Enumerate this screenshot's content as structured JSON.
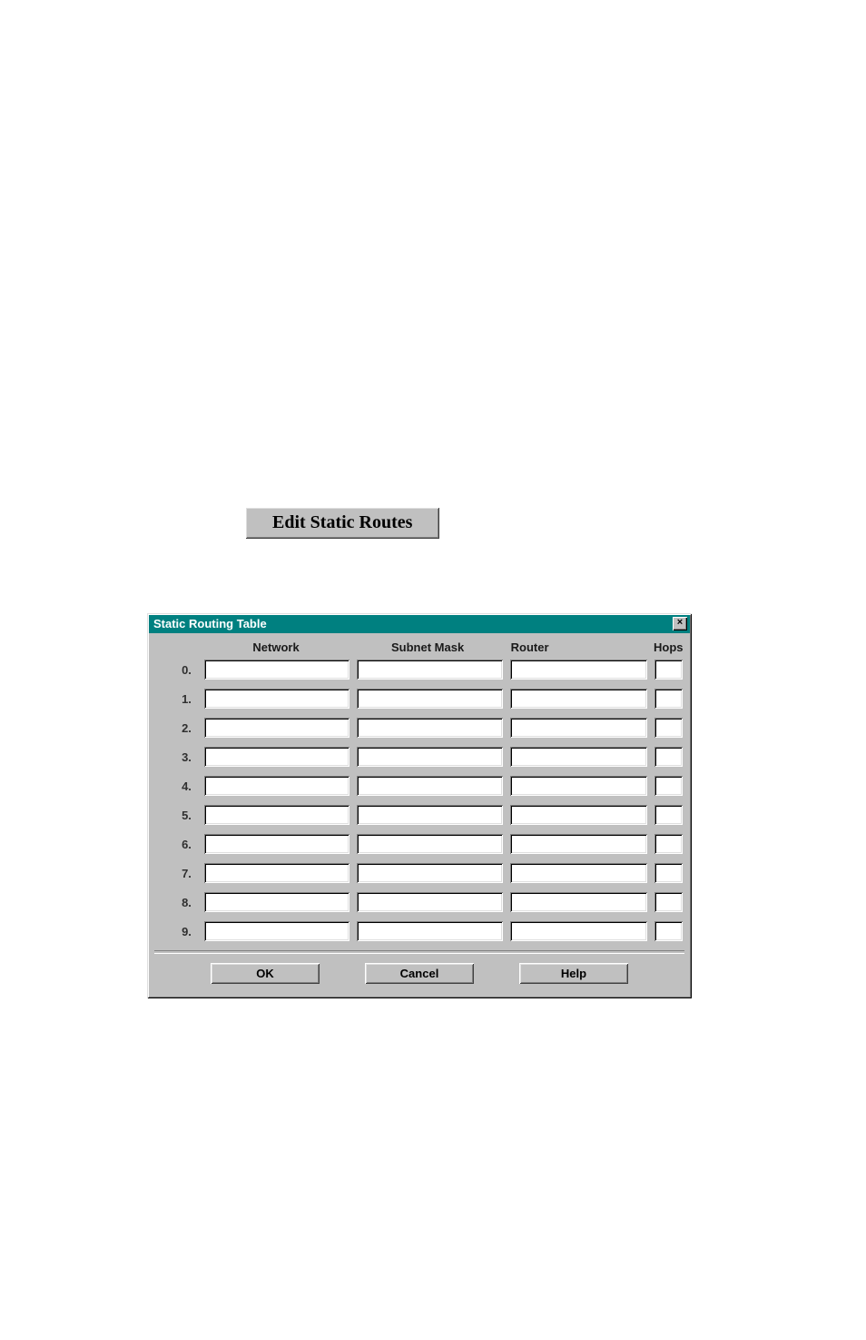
{
  "topButton": {
    "label": "Edit Static Routes"
  },
  "dialog": {
    "title": "Static Routing Table",
    "closeGlyph": "×",
    "headers": {
      "network": "Network",
      "subnet": "Subnet Mask",
      "router": "Router",
      "hops": "Hops"
    },
    "rows": [
      {
        "idx": "0.",
        "network": "",
        "subnet": "",
        "router": "",
        "hops": ""
      },
      {
        "idx": "1.",
        "network": "",
        "subnet": "",
        "router": "",
        "hops": ""
      },
      {
        "idx": "2.",
        "network": "",
        "subnet": "",
        "router": "",
        "hops": ""
      },
      {
        "idx": "3.",
        "network": "",
        "subnet": "",
        "router": "",
        "hops": ""
      },
      {
        "idx": "4.",
        "network": "",
        "subnet": "",
        "router": "",
        "hops": ""
      },
      {
        "idx": "5.",
        "network": "",
        "subnet": "",
        "router": "",
        "hops": ""
      },
      {
        "idx": "6.",
        "network": "",
        "subnet": "",
        "router": "",
        "hops": ""
      },
      {
        "idx": "7.",
        "network": "",
        "subnet": "",
        "router": "",
        "hops": ""
      },
      {
        "idx": "8.",
        "network": "",
        "subnet": "",
        "router": "",
        "hops": ""
      },
      {
        "idx": "9.",
        "network": "",
        "subnet": "",
        "router": "",
        "hops": ""
      }
    ],
    "buttons": {
      "ok": "OK",
      "cancel": "Cancel",
      "help": "Help"
    }
  }
}
